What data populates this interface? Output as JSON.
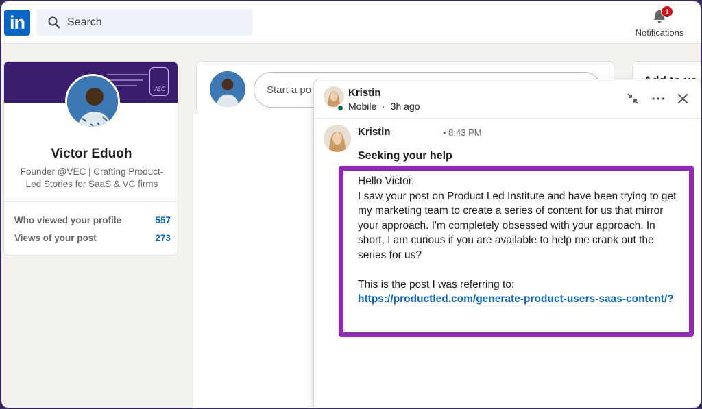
{
  "nav": {
    "logo_text": "in",
    "search_placeholder": "Search",
    "notifications_label": "Notifications",
    "notifications_count": "1"
  },
  "profile": {
    "name": "Victor Eduoh",
    "headline": "Founder @VEC | Crafting Product-Led Stories for SaaS & VC firms",
    "banner_logo_text": "VEC",
    "stats": [
      {
        "label": "Who viewed your profile",
        "value": "557"
      },
      {
        "label": "Views of your post",
        "value": "273"
      }
    ]
  },
  "feed": {
    "share_placeholder": "Start a po"
  },
  "right_card": {
    "title": "Add to yo"
  },
  "message": {
    "header_name": "Kristin",
    "status": "Mobile",
    "time_ago": "3h ago",
    "sender_name": "Kristin",
    "sent_time": "• 8:43 PM",
    "subject": "Seeking your help",
    "greeting": "Hello Victor,",
    "paragraph": "I saw your post on Product Led Institute and have been trying to get my marketing team to create a series of content for us that mirror your approach. I'm completely obsessed with your approach. In short, I am curious if you are available to help me crank out the series for us?",
    "reference_text": "This is the post I was referring to:",
    "link": "https://productled.com/generate-product-users-saas-content/?"
  },
  "colors": {
    "linkedin_blue": "#0a66c2",
    "highlight_purple": "#8e2ab5",
    "online_green": "#057642",
    "badge_red": "#cc1016"
  }
}
